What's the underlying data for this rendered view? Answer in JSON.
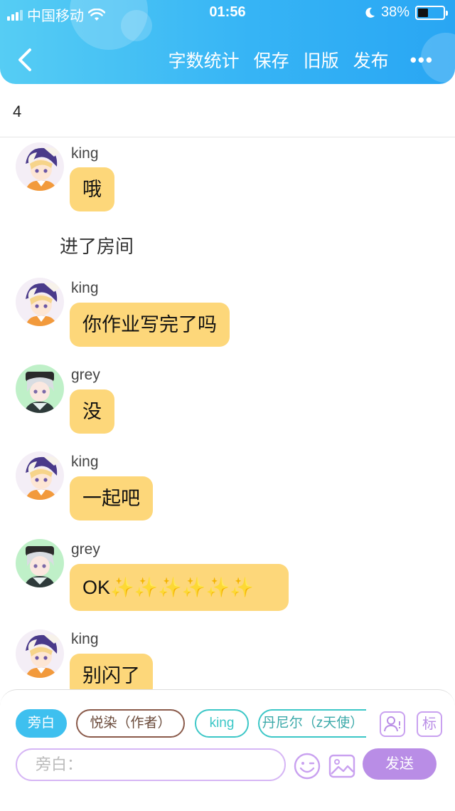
{
  "status_bar": {
    "carrier": "中国移动",
    "time": "01:56",
    "battery_percent": "38%",
    "battery_level": 0.38
  },
  "nav": {
    "back_icon": "chevron-left-icon",
    "actions": [
      "字数统计",
      "保存",
      "旧版",
      "发布"
    ],
    "more_label": "•••"
  },
  "counter": "4",
  "messages": [
    {
      "type": "chat",
      "name": "king",
      "text": "哦",
      "avatar": "king"
    },
    {
      "type": "system",
      "text": "进了房间"
    },
    {
      "type": "chat",
      "name": "king",
      "text": "你作业写完了吗",
      "avatar": "king"
    },
    {
      "type": "chat",
      "name": "grey",
      "text": "没",
      "avatar": "grey"
    },
    {
      "type": "chat",
      "name": "king",
      "text": "一起吧",
      "avatar": "king"
    },
    {
      "type": "chat",
      "name": "grey",
      "text": "OK✨✨✨✨✨✨",
      "avatar": "grey"
    },
    {
      "type": "chat",
      "name": "king",
      "text": "别闪了",
      "avatar": "king"
    }
  ],
  "roles": {
    "narrator": "旁白",
    "author": "悦染（作者）",
    "king": "king",
    "other": "丹尼尔（z天使）",
    "tag_label": "标"
  },
  "composer": {
    "placeholder": "旁白：",
    "send_label": "发送"
  },
  "colors": {
    "header_start": "#56cdf4",
    "header_end": "#29a6f3",
    "bubble": "#fdd77a",
    "accent_purple": "#b98de6",
    "chip_blue": "#3ec0ef",
    "chip_brown": "#8a5a4a",
    "chip_teal": "#3cc7c7"
  }
}
